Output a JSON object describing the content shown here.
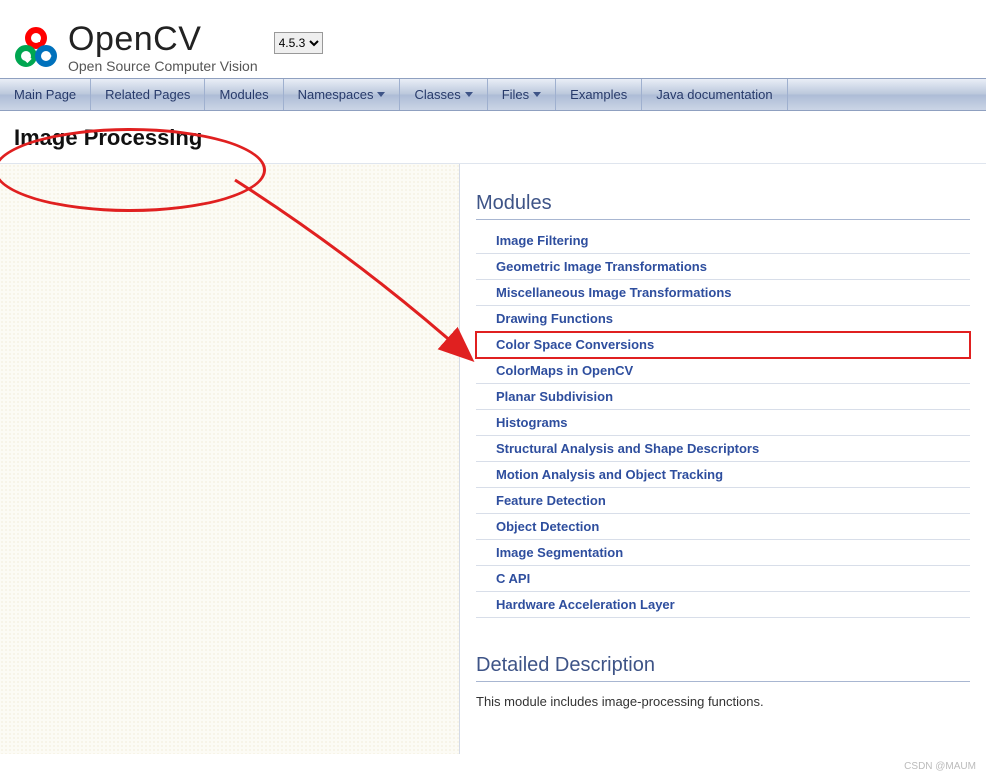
{
  "header": {
    "title": "OpenCV",
    "subtitle": "Open Source Computer Vision",
    "version_selected": "4.5.3"
  },
  "nav": {
    "main_page": "Main Page",
    "related_pages": "Related Pages",
    "modules": "Modules",
    "namespaces": "Namespaces",
    "classes": "Classes",
    "files": "Files",
    "examples": "Examples",
    "java_docs": "Java documentation"
  },
  "page_title": "Image Processing",
  "modules_section": {
    "heading": "Modules",
    "items": [
      {
        "label": "Image Filtering"
      },
      {
        "label": "Geometric Image Transformations"
      },
      {
        "label": "Miscellaneous Image Transformations"
      },
      {
        "label": "Drawing Functions"
      },
      {
        "label": "Color Space Conversions"
      },
      {
        "label": "ColorMaps in OpenCV"
      },
      {
        "label": "Planar Subdivision"
      },
      {
        "label": "Histograms"
      },
      {
        "label": "Structural Analysis and Shape Descriptors"
      },
      {
        "label": "Motion Analysis and Object Tracking"
      },
      {
        "label": "Feature Detection"
      },
      {
        "label": "Object Detection"
      },
      {
        "label": "Image Segmentation"
      },
      {
        "label": "C API"
      },
      {
        "label": "Hardware Acceleration Layer"
      }
    ],
    "highlighted_index": 4
  },
  "detailed": {
    "heading": "Detailed Description",
    "text": "This module includes image-processing functions."
  },
  "watermark": "CSDN @MAUM"
}
